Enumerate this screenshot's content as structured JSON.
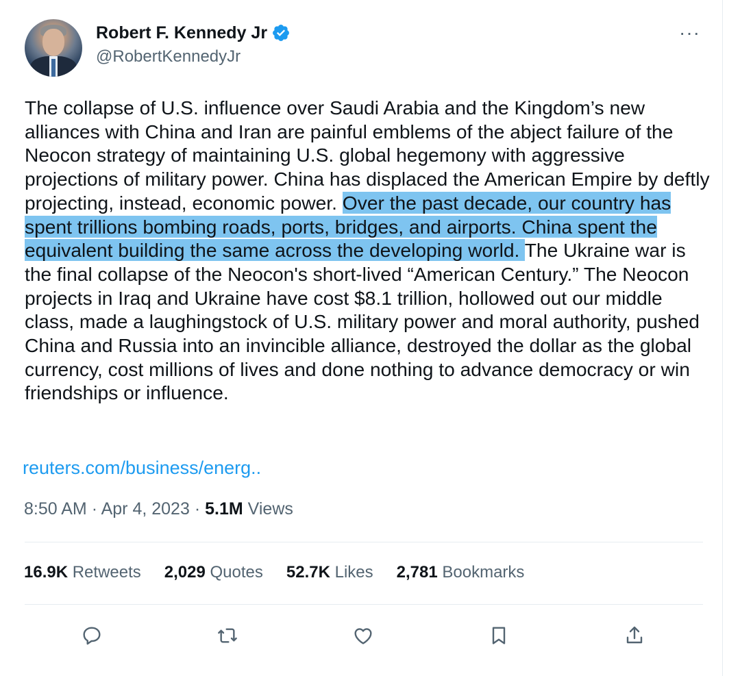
{
  "author": {
    "display_name": "Robert F. Kennedy Jr",
    "handle": "@RobertKennedyJr",
    "verified": true
  },
  "tweet": {
    "text_before_highlight": "The collapse of U.S. influence over Saudi Arabia and the Kingdom’s new alliances with China and Iran are painful emblems of the abject failure of the Neocon strategy of maintaining U.S. global hegemony with aggressive projections of military power. China has displaced the American Empire by deftly projecting, instead, economic power. ",
    "text_highlighted": "Over the past decade, our country has spent trillions bombing roads, ports, bridges, and airports. China spent the equivalent building the same across the developing world. ",
    "text_after_highlight": "The Ukraine war is the final collapse of the Neocon's short-lived “American Century.” The Neocon projects in Iraq and Ukraine have cost $8.1 trillion, hollowed out our middle class, made a laughingstock of U.S. military power and moral authority, pushed China and Russia into an invincible alliance, destroyed the dollar as the global currency, cost millions of lives and done nothing to advance democracy or win friendships or influence.",
    "link": "reuters.com/business/energ..",
    "time": "8:50 AM",
    "date": "Apr 4, 2023",
    "separator": "·",
    "views_count": "5.1M",
    "views_label": "Views"
  },
  "stats": [
    {
      "count": "16.9K",
      "label": "Retweets"
    },
    {
      "count": "2,029",
      "label": "Quotes"
    },
    {
      "count": "52.7K",
      "label": "Likes"
    },
    {
      "count": "2,781",
      "label": "Bookmarks"
    }
  ],
  "actions": [
    {
      "name": "reply",
      "icon": "reply-icon"
    },
    {
      "name": "retweet",
      "icon": "retweet-icon"
    },
    {
      "name": "like",
      "icon": "heart-icon"
    },
    {
      "name": "bookmark",
      "icon": "bookmark-icon"
    },
    {
      "name": "share",
      "icon": "share-icon"
    }
  ],
  "more_menu_glyph": "···",
  "colors": {
    "accent": "#1d9bf0",
    "highlight": "#7ec4f0",
    "secondary_text": "#536471",
    "primary_text": "#0f1419"
  }
}
